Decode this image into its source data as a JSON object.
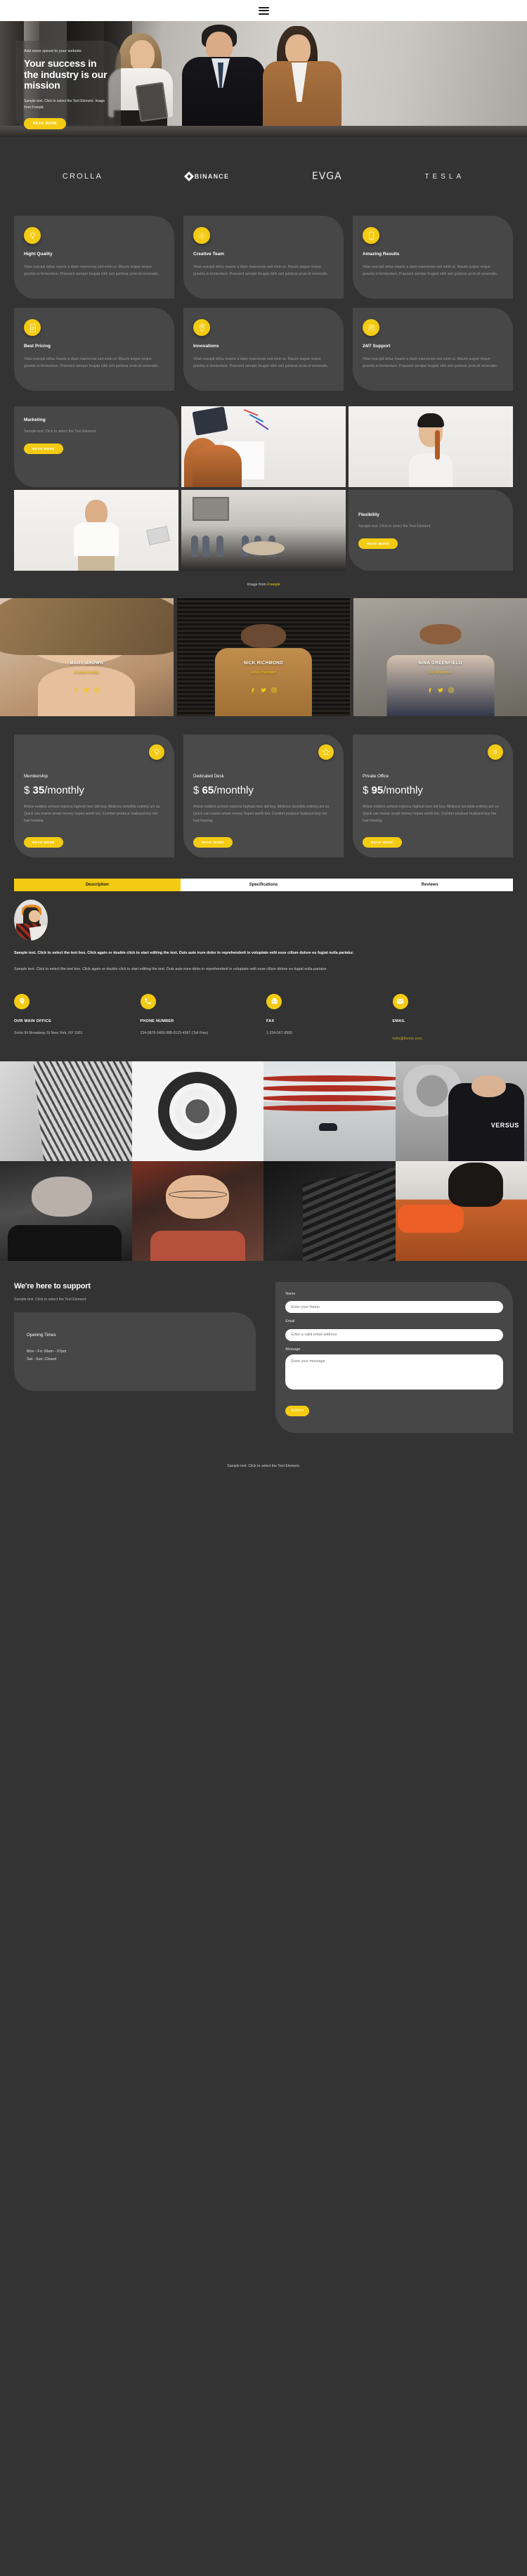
{
  "header": {
    "menu_label": "menu"
  },
  "hero": {
    "kicker": "Add more speed to your website",
    "title": "Your success in the industry is our mission",
    "subtitle": "Sample text. Click to select the Text Element. Image from Freepik",
    "button": "READ MORE"
  },
  "logos": [
    {
      "name": "CROLLA"
    },
    {
      "name": "BINANCE"
    },
    {
      "name": "EVGA"
    },
    {
      "name": "TESLA"
    }
  ],
  "features": [
    {
      "icon": "lightbulb-icon",
      "title": "Hight Quality",
      "text": "Vitae suscipit tellus mauris a diam maecenas sed enim ut. Mauris augue neque gravida in fermentum. Praesent semper feugiat nibh sed pulvinar proin id venenatis."
    },
    {
      "icon": "gear-icon",
      "title": "Creative Team",
      "text": "Vitae suscipit tellus mauris a diam maecenas sed enim ut. Mauris augue neque gravida in fermentum. Praesent semper feugiat nibh sed pulvinar proin id venenatis."
    },
    {
      "icon": "mobile-icon",
      "title": "Amazing Results",
      "text": "Vitae suscipit tellus mauris a diam maecenas sed enim ut. Mauris augue neque gravida in fermentum. Praesent semper feugiat nibh sed pulvinar proin id venenatis."
    },
    {
      "icon": "document-list-icon",
      "title": "Best Pricing",
      "text": "Vitae suscipit tellus mauris a diam maecenas sed enim ut. Mauris augue neque gravida in fermentum. Praesent semper feugiat nibh sed pulvinar proin id venenatis."
    },
    {
      "icon": "map-pin-icon",
      "title": "Innovations",
      "text": "Vitae suscipit tellus mauris a diam maecenas sed enim ut. Mauris augue neque gravida in fermentum. Praesent semper feugiat nibh sed pulvinar proin id venenatis."
    },
    {
      "icon": "users-icon",
      "title": "24/7 Support",
      "text": "Vitae suscipit tellus mauris a diam maecenas sed enim ut. Mauris augue neque gravida in fermentum. Praesent semper feugiat nibh sed pulvinar proin id venenatis."
    }
  ],
  "marketing": {
    "card1": {
      "title": "Marketing",
      "text": "Sample text. Click to select the Text Element.",
      "button": "READ MORE"
    },
    "card2": {
      "title": "Flexibility",
      "text": "Sample text. Click to select the Text Element.",
      "button": "READ MORE"
    },
    "credit_prefix": "Image from ",
    "credit_link": "Freepik"
  },
  "team": [
    {
      "name": "MARY BROWN",
      "role": "creative leader"
    },
    {
      "name": "NICK RICHMOND",
      "role": "sales manager"
    },
    {
      "name": "NINA GREENFIELD",
      "role": "top designeer"
    }
  ],
  "pricing": [
    {
      "icon": "lightbulb-icon",
      "name": "Membership",
      "currency": "$",
      "amount": "35",
      "period": "/monthly",
      "text": "Article evident arrived express highest men did boy. Mistress sensible entirely am so. Quick can manor smart money hopes worth too. Comfort produce husband boy her had hearing.",
      "button": "READ MORE"
    },
    {
      "icon": "star-icon",
      "name": "Dedicated Desk",
      "currency": "$",
      "amount": "65",
      "period": "/monthly",
      "text": "Article evident arrived express highest men did boy. Mistress sensible entirely am so. Quick can manor smart money hopes worth too. Comfort produce husband boy her had hearing.",
      "button": "READ MORE"
    },
    {
      "icon": "gear-icon",
      "name": "Private Office",
      "currency": "$",
      "amount": "95",
      "period": "/monthly",
      "text": "Article evident arrived express highest men did boy. Mistress sensible entirely am so. Quick can manor smart money hopes worth too. Comfort produce husband boy her had hearing.",
      "button": "READ MORE"
    }
  ],
  "tabs": {
    "items": [
      {
        "label": "Description",
        "active": true
      },
      {
        "label": "Specifications",
        "active": false
      },
      {
        "label": "Reviews",
        "active": false
      }
    ],
    "body_bold": "Sample text. Click to select the text box. Click again or double click to start editing the text. Duis aute irure dolor in reprehenderit in voluptate velit esse cillum dolore eu fugiat nulla pariatur.",
    "body_normal": "Sample text. Click to select the text box. Click again or double click to start editing the text. Duis aute irure dolor in reprehenderit in voluptate velit esse cillum dolore eu fugiat nulla pariatur."
  },
  "contacts": [
    {
      "icon": "map-pin-icon",
      "label": "OUR MAIN OFFICE",
      "value": "SoHo 94 Broadway St New York, NY 1001"
    },
    {
      "icon": "phone-icon",
      "label": "PHONE NUMBER",
      "value": "234-9876-5400 888-0123-4567 (Toll Free)"
    },
    {
      "icon": "fax-icon",
      "label": "FAX",
      "value": "1-234-567-8900"
    },
    {
      "icon": "envelope-icon",
      "label": "EMAIL",
      "value": "hello@theme.com"
    }
  ],
  "footer": {
    "heading": "We're here to support",
    "subtext": "Sample text. Click to select the Text Element.",
    "hours_title": "Opening Times",
    "hours_line1": "Mon - Fri: 09am - 07pm",
    "hours_line2": "Sat - Sun: Closed",
    "form": {
      "name_label": "Name",
      "name_placeholder": "Enter your Name",
      "email_label": "Email",
      "email_placeholder": "Enter a valid email address",
      "message_label": "Message",
      "message_placeholder": "Enter your message",
      "submit": "Submit"
    },
    "copyright": "Sample text. Click to select the Text Element."
  },
  "colors": {
    "accent": "#F3CB13",
    "bg": "#333333",
    "card": "#474747",
    "white": "#FFFFFF"
  }
}
